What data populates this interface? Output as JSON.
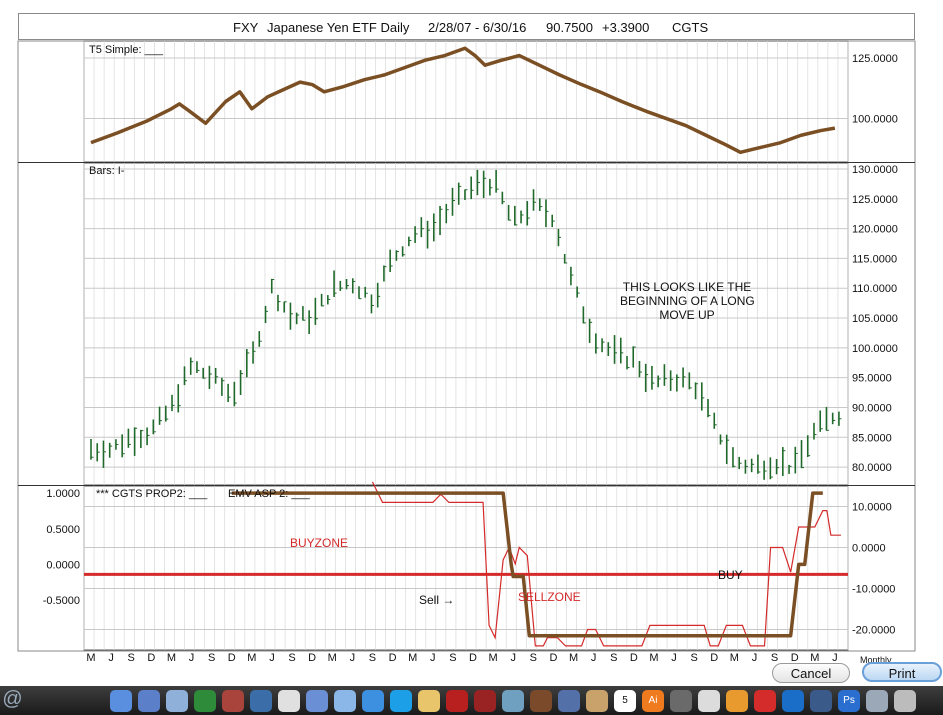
{
  "header": {
    "symbol": "FXY",
    "name": "Japanese Yen ETF Daily",
    "range": "2/28/07 - 6/30/16",
    "price": "90.7500",
    "change": "+3.3900",
    "indicator": "CGTS"
  },
  "panels": {
    "top_label": "T5 Simple: ___",
    "mid_label": "Bars: I-",
    "bottom_label1": "*** CGTS PROP2: ___",
    "bottom_label2": "EMV ASP 2: ___",
    "corner_label": "Monthly"
  },
  "annotations": {
    "note_line1": "THIS LOOKS LIKE THE",
    "note_line2": "BEGINNING OF A LONG",
    "note_line3": "MOVE UP",
    "buyzone": "BUYZONE",
    "sellzone": "SELLZONE",
    "sell": "Sell",
    "sell_arrow": "→",
    "buy": "BUY"
  },
  "buttons": {
    "cancel": "Cancel",
    "print": "Print"
  },
  "colors": {
    "brown": "#7b4f24",
    "red": "#d42a2a",
    "bar_green": "#1f6a2a",
    "grid": "#d8d8d8"
  },
  "dock": {
    "icons": [
      "finder-icon",
      "app-icon",
      "preview-icon",
      "excel-icon",
      "dictionary-icon",
      "safari-icon",
      "chrome-icon",
      "mail-icon",
      "itunes-icon",
      "appstore-icon",
      "skype-icon",
      "photos-icon",
      "acrobat-icon",
      "record-icon",
      "timemachine-icon",
      "photobooth-icon",
      "xcode-icon",
      "contacts-icon",
      "calendar-icon",
      "illustrator-icon",
      "instruments-icon",
      "textedit-icon",
      "pages-icon",
      "opera-icon",
      "teamviewer-icon",
      "screenflow-icon",
      "photoshop-icon",
      "launchpad-icon",
      "trash-icon"
    ],
    "calendar_day": "5",
    "illustrator_label": "Ai",
    "photoshop_label": "Ps"
  },
  "chart_data": [
    {
      "type": "line",
      "title": "T5 Simple",
      "xlabel": "",
      "ylabel": "",
      "ylim": [
        82,
        132
      ],
      "yticks": [
        "125.0000",
        "100.0000"
      ],
      "x_tick_labels": [
        "M",
        "J",
        "S",
        "D",
        "M",
        "J",
        "S",
        "D",
        "M",
        "J",
        "S",
        "D",
        "M",
        "J",
        "S",
        "D",
        "M",
        "J",
        "S",
        "D",
        "M",
        "J",
        "S",
        "D",
        "M",
        "J",
        "S",
        "D",
        "M",
        "J",
        "S",
        "D",
        "M",
        "J",
        "S",
        "D",
        "M",
        "J"
      ],
      "series": [
        {
          "color": "#7b4f24",
          "points": [
            [
              0,
              90
            ],
            [
              1.3,
              94
            ],
            [
              2.8,
              99
            ],
            [
              4,
              104
            ],
            [
              4.4,
              106
            ],
            [
              4.9,
              103
            ],
            [
              5.7,
              98
            ],
            [
              6.7,
              107
            ],
            [
              7.4,
              111
            ],
            [
              8,
              104
            ],
            [
              8.8,
              109
            ],
            [
              9.6,
              112
            ],
            [
              10.4,
              115
            ],
            [
              11,
              114
            ],
            [
              11.6,
              111
            ],
            [
              12.5,
              113
            ],
            [
              13.6,
              116
            ],
            [
              14.6,
              118
            ],
            [
              15.6,
              121
            ],
            [
              16.6,
              124
            ],
            [
              17.6,
              126
            ],
            [
              18.6,
              129
            ],
            [
              19.1,
              126
            ],
            [
              19.6,
              122
            ],
            [
              20.4,
              124
            ],
            [
              21.3,
              126
            ],
            [
              22.3,
              122
            ],
            [
              23.3,
              118
            ],
            [
              24.4,
              114
            ],
            [
              25.3,
              111
            ],
            [
              26.4,
              107
            ],
            [
              27.6,
              103
            ],
            [
              28.6,
              100
            ],
            [
              29.6,
              97
            ],
            [
              30.6,
              93
            ],
            [
              31.6,
              89
            ],
            [
              32.3,
              86
            ],
            [
              33.3,
              88
            ],
            [
              34.3,
              90
            ],
            [
              35.3,
              93
            ],
            [
              36.3,
              95
            ],
            [
              37,
              96
            ]
          ]
        }
      ]
    },
    {
      "type": "bar",
      "title": "Bars",
      "xlabel": "",
      "ylabel": "",
      "ylim": [
        77,
        131
      ],
      "yticks": [
        "130.0000",
        "125.0000",
        "120.0000",
        "115.0000",
        "110.0000",
        "105.0000",
        "100.0000",
        "95.0000",
        "90.0000",
        "85.0000",
        "80.0000"
      ],
      "anchors": [
        [
          0,
          83
        ],
        [
          1,
          83
        ],
        [
          2,
          85
        ],
        [
          3,
          86
        ],
        [
          4,
          90
        ],
        [
          5,
          97
        ],
        [
          6,
          95
        ],
        [
          7,
          92
        ],
        [
          8,
          98
        ],
        [
          9,
          110
        ],
        [
          10,
          105
        ],
        [
          11,
          105
        ],
        [
          12,
          110
        ],
        [
          13,
          111
        ],
        [
          14,
          108
        ],
        [
          15,
          115
        ],
        [
          16,
          119
        ],
        [
          17,
          120
        ],
        [
          18,
          124
        ],
        [
          19,
          127
        ],
        [
          20,
          128
        ],
        [
          21,
          121
        ],
        [
          22,
          124
        ],
        [
          23,
          122
        ],
        [
          24,
          110
        ],
        [
          25,
          102
        ],
        [
          26,
          99
        ],
        [
          27,
          98
        ],
        [
          28,
          94
        ],
        [
          29,
          95
        ],
        [
          30,
          94
        ],
        [
          31,
          87
        ],
        [
          32,
          81
        ],
        [
          33,
          80
        ],
        [
          34,
          81
        ],
        [
          35,
          80
        ],
        [
          36,
          86
        ],
        [
          37,
          89
        ]
      ]
    },
    {
      "type": "line",
      "title": "CGTS PROP2 / EMV ASP 2",
      "xlabel": "",
      "ylabel": "",
      "left_ylim": [
        -1.2,
        1.1
      ],
      "right_ylim": [
        -25,
        15
      ],
      "left_yticks": [
        "1.0000",
        "0.5000",
        "0.0000",
        "-0.5000"
      ],
      "right_yticks": [
        "10.0000",
        "0.0000",
        "-10.0000",
        "-20.0000"
      ],
      "threshold": -0.14,
      "series": [
        {
          "name": "*** CGTS PROP2",
          "color": "#7b4f24",
          "points": [
            [
              7,
              1.0
            ],
            [
              20.5,
              1.0
            ],
            [
              20.9,
              0.0
            ],
            [
              21,
              -0.17
            ],
            [
              21.5,
              -0.17
            ],
            [
              21.8,
              -1.0
            ],
            [
              34.8,
              -1.0
            ],
            [
              35.2,
              0.0
            ],
            [
              35.5,
              0.0
            ],
            [
              35.9,
              1.0
            ],
            [
              36.4,
              1.0
            ]
          ]
        },
        {
          "name": "EMV ASP 2",
          "color": "#d42a2a",
          "points": [
            [
              14,
              16
            ],
            [
              14.5,
              11
            ],
            [
              17,
              11
            ],
            [
              17.4,
              13
            ],
            [
              17.8,
              11
            ],
            [
              19.5,
              11
            ],
            [
              19.8,
              -19
            ],
            [
              20.1,
              -22
            ],
            [
              20.5,
              -3
            ],
            [
              20.8,
              0
            ],
            [
              21.1,
              -4
            ],
            [
              21.3,
              0
            ],
            [
              21.7,
              -2
            ],
            [
              22.1,
              -24
            ],
            [
              22.5,
              -24
            ],
            [
              22.7,
              -22
            ],
            [
              23.2,
              -22
            ],
            [
              23.6,
              -24
            ],
            [
              24.4,
              -24
            ],
            [
              24.7,
              -20
            ],
            [
              25.1,
              -20
            ],
            [
              25.5,
              -24
            ],
            [
              27.4,
              -24
            ],
            [
              27.8,
              -19
            ],
            [
              30.5,
              -19
            ],
            [
              30.8,
              -24
            ],
            [
              31.2,
              -24
            ],
            [
              31.6,
              -19
            ],
            [
              32.4,
              -19
            ],
            [
              32.8,
              -24
            ],
            [
              33.5,
              -24
            ],
            [
              33.8,
              0
            ],
            [
              34.4,
              0
            ],
            [
              34.8,
              -6
            ],
            [
              35.2,
              5
            ],
            [
              36,
              5
            ],
            [
              36.4,
              9
            ],
            [
              36.6,
              9
            ],
            [
              36.8,
              3
            ],
            [
              37.3,
              3
            ]
          ]
        }
      ]
    }
  ]
}
